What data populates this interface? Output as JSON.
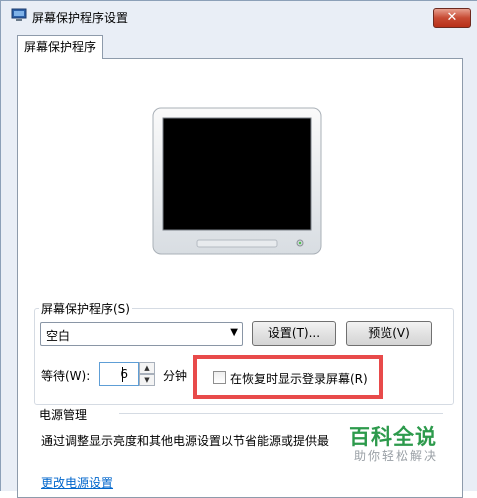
{
  "window": {
    "title": "屏幕保护程序设置",
    "close_label": "✕"
  },
  "tabs": [
    {
      "label": "屏幕保护程序"
    }
  ],
  "screensaver": {
    "group_label": "屏幕保护程序(S)",
    "selected": "空白",
    "settings_button": "设置(T)...",
    "preview_button": "预览(V)",
    "wait_label": "等待(W):",
    "wait_value": "6",
    "wait_unit": "分钟",
    "resume_checkbox_label": "在恢复时显示登录屏幕(R)",
    "resume_checked": false
  },
  "power": {
    "group_label": "电源管理",
    "description": "通过调整显示亮度和其他电源设置以节省能源或提供最",
    "link": "更改电源设置"
  },
  "watermark": {
    "main": "百科全说",
    "sub": "助你轻松解决"
  },
  "colors": {
    "highlight": "#e84a4a",
    "link": "#0066cc",
    "watermark": "#2d9a4c"
  },
  "icons": [
    "screensaver-app-icon",
    "monitor-icon",
    "dropdown-arrow-icon",
    "spin-up-icon",
    "spin-down-icon"
  ]
}
